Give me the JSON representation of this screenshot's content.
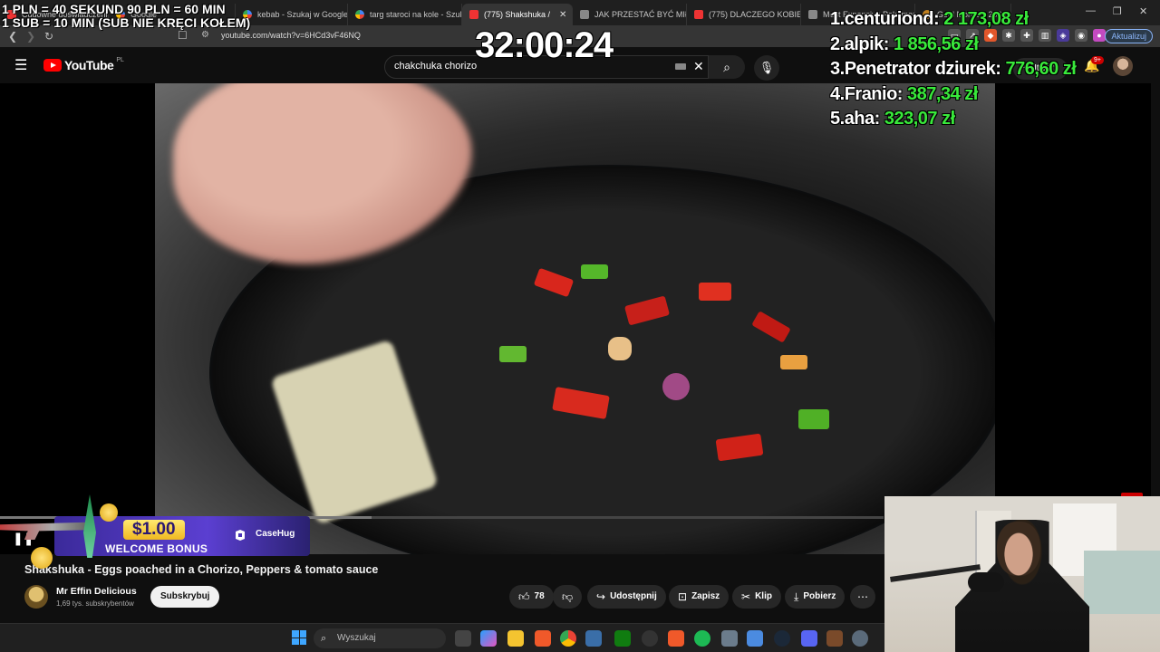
{
  "browser": {
    "tabs": [
      {
        "label": "Cudowne doświadczenie",
        "favicon": "youtube-icon",
        "active": false
      },
      {
        "label": "Google",
        "favicon": "google-icon",
        "active": false
      },
      {
        "label": "kebab - Szukaj w Google",
        "favicon": "google-icon",
        "active": false
      },
      {
        "label": "targ staroci na kole - Szuk",
        "favicon": "google-icon",
        "active": false
      },
      {
        "label": "(775) Shakshuka /",
        "favicon": "youtube-icon",
        "active": true
      },
      {
        "label": "JAK PRZESTAĆ BYĆ MIŁYM",
        "favicon": "page-icon",
        "active": false
      },
      {
        "label": "(775) DLACZEGO KOBIETY",
        "favicon": "youtube-icon",
        "active": false
      },
      {
        "label": "Most Expensive Pokemon",
        "favicon": "page-icon",
        "active": false
      },
      {
        "label": "Gold Monster 2000 - Sk",
        "favicon": "gold-icon",
        "active": false
      }
    ],
    "url": "youtube.com/watch?v=6HCd3vF46NQ",
    "update_label": "Aktualizuj"
  },
  "youtube": {
    "logo_text": "YouTube",
    "country_code": "PL",
    "search_value": "chakchuka chorizo",
    "create_label": "+ Utwórz",
    "notifications_count": "9+",
    "video": {
      "title": "Shakshuka - Eggs poached in a Chorizo, Peppers & tomato sauce",
      "channel": "Mr Effin Delicious",
      "subscribers": "1,69 tys. subskrybentów",
      "subscribe_label": "Subskrybuj",
      "likes": "78",
      "share_label": "Udostępnij",
      "save_label": "Zapisz",
      "clip_label": "Klip",
      "download_label": "Pobierz",
      "progress_fraction": 0.42
    }
  },
  "taskbar": {
    "search_placeholder": "Wyszukaj"
  },
  "stream_overlay": {
    "rule_line1": "1 PLN = 40 SEKUND 90 PLN = 60 MIN",
    "rule_line2": "1 SUB = 10 MIN (SUB NIE KRĘCI KOŁEM)",
    "timer": "32:00:24",
    "leaderboard": [
      {
        "rank": "1.",
        "name": "centuriond:",
        "amount": "2 173,08 zł"
      },
      {
        "rank": "2.",
        "name": "alpik:",
        "amount": "1 856,56 zł"
      },
      {
        "rank": "3.",
        "name": "Penetrator dziurek:",
        "amount": "776,60 zł"
      },
      {
        "rank": "4.",
        "name": "Franio:",
        "amount": "387,34 zł"
      },
      {
        "rank": "5.",
        "name": "aha:",
        "amount": "323,07 zł"
      }
    ],
    "promo": {
      "amount": "$1.00",
      "text": "WELCOME BONUS",
      "brand": "CaseHug"
    }
  },
  "colors": {
    "leaderboard_amount": "#39e93b",
    "youtube_red": "#ff0000",
    "accent_blue": "#8ab4f8"
  }
}
